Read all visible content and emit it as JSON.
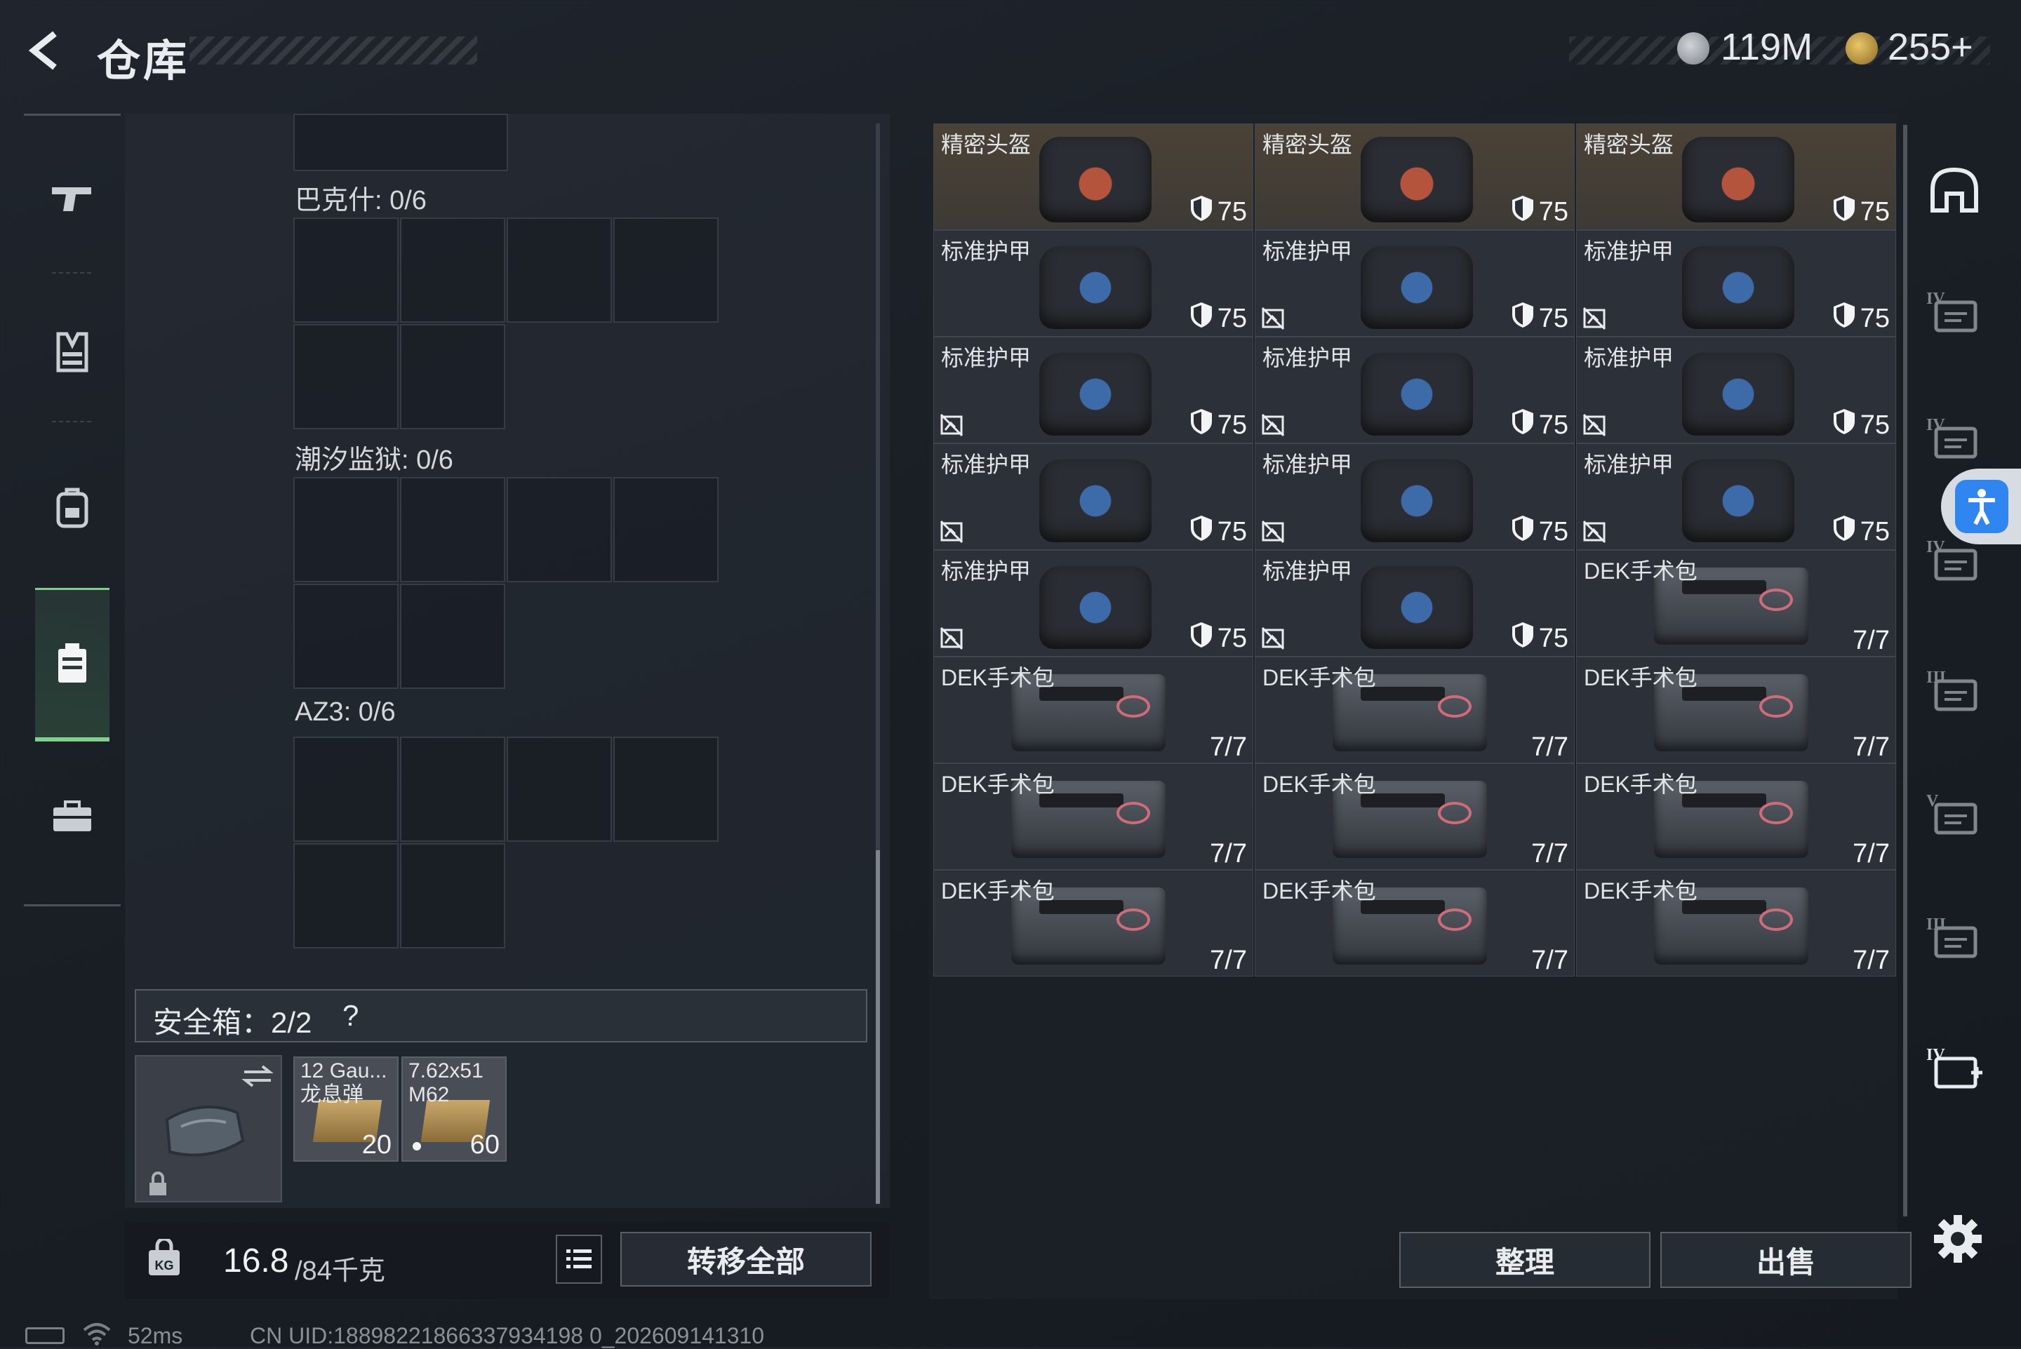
{
  "header": {
    "title": "仓库",
    "money": "119M",
    "gold": "255+"
  },
  "sidebar": {
    "items": [
      {
        "icon": "pistol-icon"
      },
      {
        "icon": "vest-icon"
      },
      {
        "icon": "backpack-icon"
      },
      {
        "icon": "container-icon",
        "active": true
      },
      {
        "icon": "briefcase-icon"
      }
    ]
  },
  "sections": [
    {
      "label": "巴克什: 0/6"
    },
    {
      "label": "潮汐监狱: 0/6"
    },
    {
      "label": "AZ3: 0/6"
    }
  ],
  "safe_box": {
    "label": "安全箱：2/2",
    "help": "?"
  },
  "ammo": [
    {
      "name1": "12 Gau...",
      "name2": "龙息弹",
      "count": "20"
    },
    {
      "name1": "7.62x51",
      "name2": "M62",
      "count": "60"
    }
  ],
  "weight": {
    "value": "16.8",
    "max": "/84千克"
  },
  "buttons": {
    "transfer_all": "转移全部",
    "sort": "整理",
    "sell": "出售"
  },
  "items": [
    {
      "name": "精密头盔",
      "value": "75",
      "type": "helm",
      "broken": false
    },
    {
      "name": "精密头盔",
      "value": "75",
      "type": "helm",
      "broken": false
    },
    {
      "name": "精密头盔",
      "value": "75",
      "type": "helm",
      "broken": false
    },
    {
      "name": "标准护甲",
      "value": "75",
      "type": "vest",
      "broken": false
    },
    {
      "name": "标准护甲",
      "value": "75",
      "type": "vest",
      "broken": true
    },
    {
      "name": "标准护甲",
      "value": "75",
      "type": "vest",
      "broken": true
    },
    {
      "name": "标准护甲",
      "value": "75",
      "type": "vest",
      "broken": true
    },
    {
      "name": "标准护甲",
      "value": "75",
      "type": "vest",
      "broken": true
    },
    {
      "name": "标准护甲",
      "value": "75",
      "type": "vest",
      "broken": true
    },
    {
      "name": "标准护甲",
      "value": "75",
      "type": "vest",
      "broken": true
    },
    {
      "name": "标准护甲",
      "value": "75",
      "type": "vest",
      "broken": true
    },
    {
      "name": "标准护甲",
      "value": "75",
      "type": "vest",
      "broken": true
    },
    {
      "name": "标准护甲",
      "value": "75",
      "type": "vest",
      "broken": true
    },
    {
      "name": "标准护甲",
      "value": "75",
      "type": "vest",
      "broken": true
    },
    {
      "name": "DEK手术包",
      "value": "7/7",
      "type": "kit",
      "broken": false
    },
    {
      "name": "DEK手术包",
      "value": "7/7",
      "type": "kit",
      "broken": false
    },
    {
      "name": "DEK手术包",
      "value": "7/7",
      "type": "kit",
      "broken": false
    },
    {
      "name": "DEK手术包",
      "value": "7/7",
      "type": "kit",
      "broken": false
    },
    {
      "name": "DEK手术包",
      "value": "7/7",
      "type": "kit",
      "broken": false
    },
    {
      "name": "DEK手术包",
      "value": "7/7",
      "type": "kit",
      "broken": false
    },
    {
      "name": "DEK手术包",
      "value": "7/7",
      "type": "kit",
      "broken": false
    },
    {
      "name": "DEK手术包",
      "value": "7/7",
      "type": "kit",
      "broken": false
    },
    {
      "name": "DEK手术包",
      "value": "7/7",
      "type": "kit",
      "broken": false
    },
    {
      "name": "DEK手术包",
      "value": "7/7",
      "type": "kit",
      "broken": false
    }
  ],
  "right_sidebar": {
    "icons": [
      "helmet-slot-icon",
      "armor-iv-icon",
      "armor-iv-2-icon",
      "armor-iv-3-icon",
      "armor-iii-icon",
      "armor-v-icon",
      "armor-iii-2-icon",
      "armor-iv-add-icon"
    ]
  },
  "status": {
    "ping": "52ms",
    "uid": "CN UID:18898221866337934198 0_202609141310"
  }
}
